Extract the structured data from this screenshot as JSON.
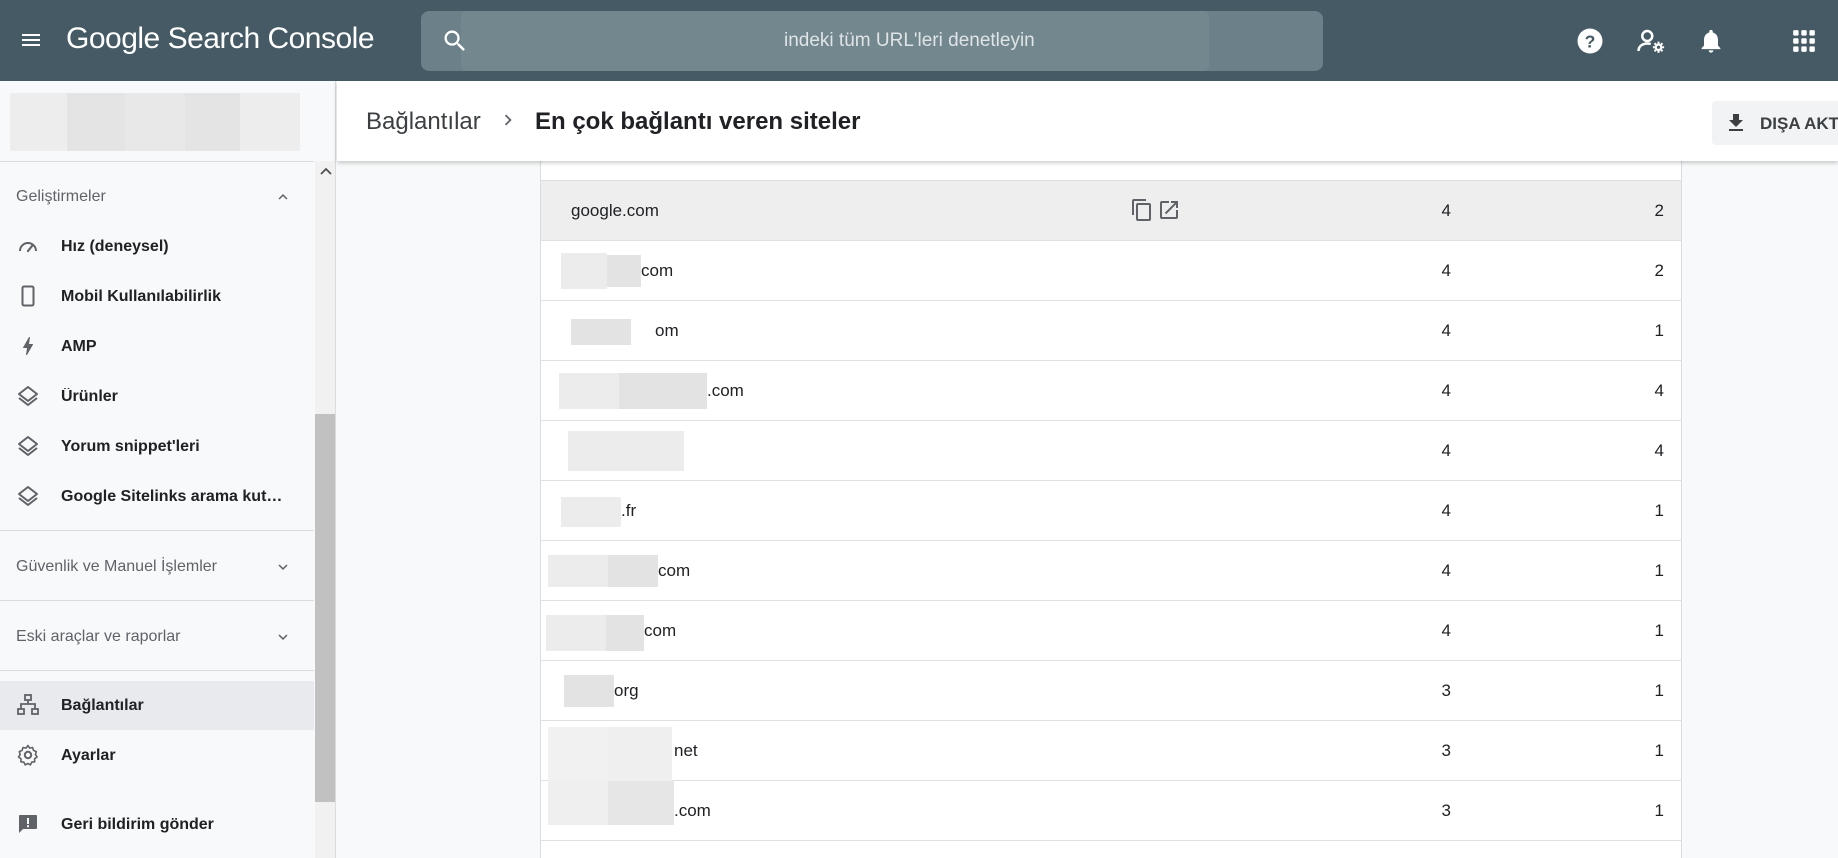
{
  "header": {
    "logo": "Google Search Console",
    "search_placeholder": "indeki tüm URL'leri denetleyin",
    "icons": [
      "menu-icon",
      "search-icon",
      "help-icon",
      "manage-accounts-icon",
      "notifications-icon",
      "apps-icon"
    ]
  },
  "sidebar": {
    "sections": {
      "enhancements": "Geliştirmeler",
      "security": "Güvenlik ve Manuel İşlemler",
      "legacy": "Eski araçlar ve raporlar"
    },
    "items": [
      {
        "label": "Hız (deneysel)",
        "icon": "speed-icon"
      },
      {
        "label": "Mobil Kullanılabilirlik",
        "icon": "smartphone-icon"
      },
      {
        "label": "AMP",
        "icon": "bolt-icon"
      },
      {
        "label": "Ürünler",
        "icon": "layers-icon"
      },
      {
        "label": "Yorum snippet'leri",
        "icon": "layers-icon"
      },
      {
        "label": "Google Sitelinks arama kutu…",
        "icon": "layers-icon"
      },
      {
        "label": "Bağlantılar",
        "icon": "sitemap-icon",
        "active": true
      },
      {
        "label": "Ayarlar",
        "icon": "gear-icon"
      },
      {
        "label": "Geri bildirim gönder",
        "icon": "feedback-icon"
      }
    ]
  },
  "page": {
    "breadcrumb_parent": "Bağlantılar",
    "breadcrumb_current": "En çok bağlantı veren siteler",
    "export_label": "DIŞA AKT"
  },
  "table": {
    "rows": [
      {
        "site": "google.com",
        "links": "4",
        "pages": "2"
      },
      {
        "site": "com",
        "links": "4",
        "pages": "2"
      },
      {
        "site": "om",
        "links": "4",
        "pages": "1"
      },
      {
        "site": ".com",
        "links": "4",
        "pages": "4"
      },
      {
        "site": "",
        "links": "4",
        "pages": "4"
      },
      {
        "site": ".fr",
        "links": "4",
        "pages": "1"
      },
      {
        "site": "com",
        "links": "4",
        "pages": "1"
      },
      {
        "site": "com",
        "links": "4",
        "pages": "1"
      },
      {
        "site": "org",
        "links": "3",
        "pages": "1"
      },
      {
        "site": "net",
        "links": "3",
        "pages": "1"
      },
      {
        "site": ".com",
        "links": "3",
        "pages": "1"
      }
    ]
  },
  "colors": {
    "topbar": "#455a64",
    "active_nav": "#e8eaed",
    "row_hover": "#eeeeee"
  }
}
